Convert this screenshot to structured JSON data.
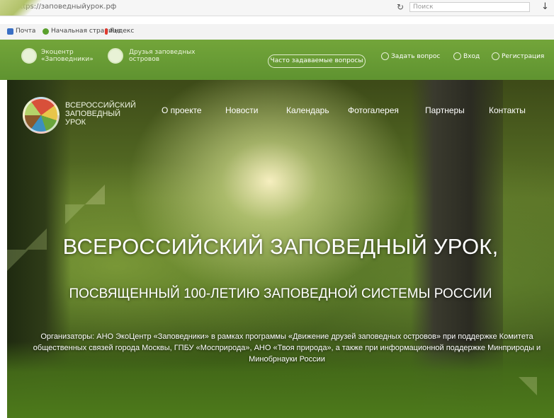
{
  "browser": {
    "url": "https://заповедныйурок.рф",
    "reload_icon": "reload-icon",
    "search_placeholder": "Поиск",
    "download_icon": "download-arrow-icon"
  },
  "bookmarks": {
    "items": [
      {
        "label": "Почта",
        "icon": "mail-icon",
        "color": "#3a6fc4"
      },
      {
        "label": "Начальная страница",
        "icon": "home-icon",
        "color": "#5aa02c"
      },
      {
        "label": "Яндекс",
        "icon": "yandex-icon",
        "color": "#e03a2f"
      }
    ]
  },
  "topbar": {
    "ecocenter": "Экоцентр «Заповедники»",
    "friends": "Друзья заповедных островов",
    "faq": "Часто задаваемые вопросы",
    "ask": "Задать вопрос",
    "login": "Вход",
    "register": "Регистрация"
  },
  "site": {
    "title": "ВСЕРОССИЙСКИЙ ЗАПОВЕДНЫЙ УРОК",
    "nav": [
      "О проекте",
      "Новости",
      "Календарь",
      "Фотогалерея",
      "Партнеры",
      "Контакты"
    ]
  },
  "hero": {
    "heading": "ВСЕРОССИЙСКИЙ ЗАПОВЕДНЫЙ УРОК,",
    "subheading": "ПОСВЯЩЕННЫЙ 100-ЛЕТИЮ ЗАПОВЕДНОЙ СИСТЕМЫ РОССИИ",
    "organizers": "Организаторы: АНО ЭкоЦентр «Заповедники» в рамках программы «Движение друзей заповедных островов» при поддержке Комитета общественных связей города Москвы, ГПБУ «Мосприрода», АНО «Твоя природа», а также при информационной поддержке Минприроды и Минобрнауки России"
  },
  "colors": {
    "header_green": "#6a9e36",
    "text_white": "#ffffff"
  }
}
